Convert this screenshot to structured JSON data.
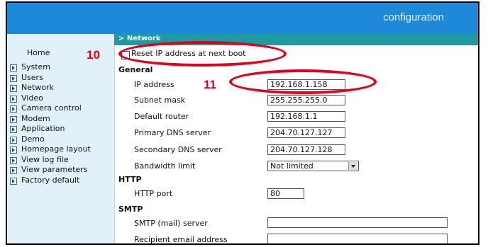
{
  "app": {
    "title": "configuration"
  },
  "sidebar": {
    "home": "Home",
    "items": [
      {
        "label": "System"
      },
      {
        "label": "Users"
      },
      {
        "label": "Network"
      },
      {
        "label": "Video"
      },
      {
        "label": "Camera control"
      },
      {
        "label": "Modem"
      },
      {
        "label": "Application"
      },
      {
        "label": "Demo"
      },
      {
        "label": "Homepage layout"
      },
      {
        "label": "View log file"
      },
      {
        "label": "View parameters"
      },
      {
        "label": "Factory default"
      }
    ]
  },
  "section": {
    "title": "> Network"
  },
  "reset": {
    "label": "Reset IP address at next boot",
    "checked": false
  },
  "general": {
    "heading": "General",
    "ip_label": "IP address",
    "ip_value": "192.168.1.158",
    "subnet_label": "Subnet mask",
    "subnet_value": "255.255.255.0",
    "router_label": "Default router",
    "router_value": "192.168.1.1",
    "dns1_label": "Primary DNS server",
    "dns1_value": "204.70.127.127",
    "dns2_label": "Secondary DNS server",
    "dns2_value": "204.70.127.128",
    "bw_label": "Bandwidth limit",
    "bw_value": "Not limited"
  },
  "http": {
    "heading": "HTTP",
    "port_label": "HTTP port",
    "port_value": "80"
  },
  "smtp": {
    "heading": "SMTP",
    "server_label": "SMTP (mail) server",
    "server_value": "",
    "recipient_label": "Recipient email address",
    "recipient_value": ""
  },
  "annotations": {
    "callout_10": "10",
    "callout_11": "11",
    "color": "#e0001b"
  }
}
